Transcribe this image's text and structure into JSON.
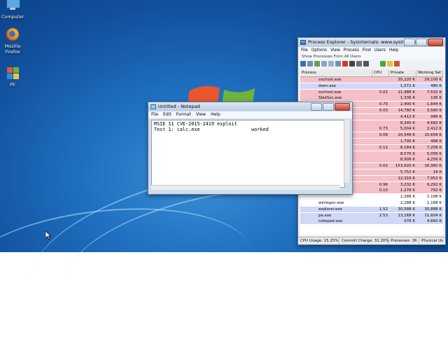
{
  "desktop": {
    "icons": [
      {
        "label": "Computer",
        "icon": "computer-icon"
      },
      {
        "label": "Mozilla Firefox",
        "icon": "firefox-icon"
      },
      {
        "label": "PE",
        "icon": "pe-icon"
      }
    ]
  },
  "notepad": {
    "title": "Untitled - Notepad",
    "menu": [
      "File",
      "Edit",
      "Format",
      "View",
      "Help"
    ],
    "text": "MSIE 11 CVE-2015-2419 exploit\nTest 1: calc.exe                  worked"
  },
  "procexp": {
    "title": "Process Explorer - Sysinternals: www.sysinternals.co...",
    "menu": [
      "File",
      "Options",
      "View",
      "Process",
      "Find",
      "Users",
      "Help"
    ],
    "filter_text": "Show Processes From All Users",
    "columns": [
      "Process",
      "CPU",
      "Private Bytes",
      "Working Set"
    ],
    "rows": [
      {
        "name": "svchost.exe",
        "cpu": "",
        "private": "35,220 K",
        "working": "29,100 K",
        "color": "#f6c0c8"
      },
      {
        "name": "dwm.exe",
        "cpu": "",
        "private": "1,072 K",
        "working": "480 K",
        "color": "#cfd8f7"
      },
      {
        "name": "svchost.exe",
        "cpu": "0.02",
        "private": "11,988 K",
        "working": "7,532 K",
        "color": "#f6c0c8"
      },
      {
        "name": "SbieSvc.exe",
        "cpu": "",
        "private": "1,336 K",
        "working": "136 K",
        "color": "#f6c0c8"
      },
      {
        "name": "",
        "cpu": "0.70",
        "private": "2,400 K",
        "working": "1,644 K",
        "color": "#f6c0c8"
      },
      {
        "name": "",
        "cpu": "0.03",
        "private": "14,780 K",
        "working": "3,560 K",
        "color": "#f6c0c8"
      },
      {
        "name": "",
        "cpu": "",
        "private": "4,412 K",
        "working": "996 K",
        "color": "#f6c0c8"
      },
      {
        "name": "",
        "cpu": "",
        "private": "8,340 K",
        "working": "4,692 K",
        "color": "#f6c0c8"
      },
      {
        "name": "",
        "cpu": "0.73",
        "private": "5,004 K",
        "working": "2,412 K",
        "color": "#f6c0c8"
      },
      {
        "name": "",
        "cpu": "0.06",
        "private": "20,548 K",
        "working": "15,656 K",
        "color": "#f6c0c8"
      },
      {
        "name": "",
        "cpu": "",
        "private": "1,700 K",
        "working": "496 K",
        "color": "#f6c0c8"
      },
      {
        "name": "",
        "cpu": "0.12",
        "private": "8,184 K",
        "working": "7,256 K",
        "color": "#f6c0c8"
      },
      {
        "name": "",
        "cpu": "",
        "private": "8,576 K",
        "working": "5,056 K",
        "color": "#f6c0c8"
      },
      {
        "name": "",
        "cpu": "",
        "private": "8,908 K",
        "working": "4,256 K",
        "color": "#f6c0c8"
      },
      {
        "name": "",
        "cpu": "0.02",
        "private": "153,920 K",
        "working": "16,360 K",
        "color": "#f6c0c8"
      },
      {
        "name": "",
        "cpu": "",
        "private": "5,752 K",
        "working": "16 K",
        "color": "#f6c0c8"
      },
      {
        "name": "",
        "cpu": "",
        "private": "12,316 K",
        "working": "7,952 K",
        "color": "#f6c0c8"
      },
      {
        "name": "",
        "cpu": "0.96",
        "private": "3,232 K",
        "working": "9,292 K",
        "color": "#f6c0c8"
      },
      {
        "name": "",
        "cpu": "0.10",
        "private": "1,276 K",
        "working": "792 K",
        "color": "#f6c0c8"
      },
      {
        "name": "",
        "cpu": "",
        "private": "2,288 K",
        "working": "1,188 K",
        "color": "#ffffff"
      },
      {
        "name": "winlogon.exe",
        "cpu": "",
        "private": "2,288 K",
        "working": "1,188 K",
        "color": "#ffffff"
      },
      {
        "name": "explorer.exe",
        "cpu": "1.52",
        "private": "30,588 K",
        "working": "30,888 K",
        "color": "#cfd8f7"
      },
      {
        "name": "pe.exe",
        "cpu": "2.53",
        "private": "13,168 K",
        "working": "11,604 K",
        "color": "#cfd8f7"
      },
      {
        "name": "notepad.exe",
        "cpu": "",
        "private": "976 K",
        "working": "4,660 K",
        "color": "#cfd8f7"
      }
    ],
    "status": {
      "cpu_usage": "CPU Usage: 15.25%",
      "commit": "Commit Charge: 31.20%",
      "processes": "Processes: 36",
      "physical": "Physical Us"
    }
  }
}
